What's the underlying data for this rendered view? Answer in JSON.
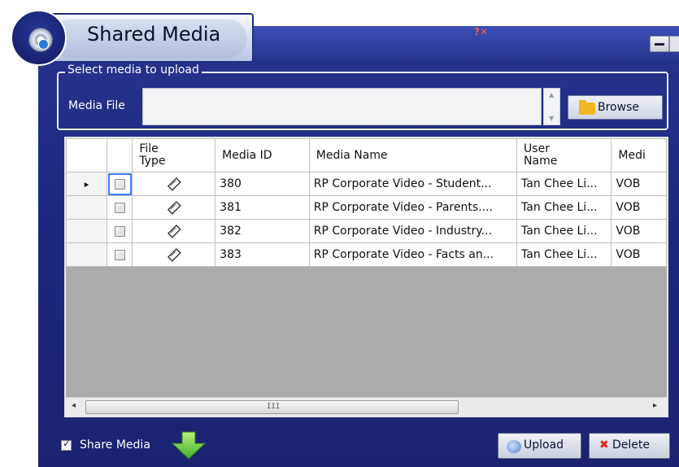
{
  "window": {
    "title": "Shared Media",
    "close_glyph": "?✕",
    "minimize_icon": "minimize-icon",
    "colors": {
      "frame": "#1d287e",
      "accent": "#3c4fb5",
      "group_border": "#e9ecf6",
      "grid_bg": "#ababab"
    }
  },
  "upload_section": {
    "legend": "Select media to upload",
    "media_file_label": "Media File",
    "media_file_value": "",
    "browse_label": "Browse",
    "browse_icon": "folder-icon"
  },
  "grid": {
    "columns": [
      "",
      "",
      "File Type",
      "Media ID",
      "Media Name",
      "User Name",
      "Medi"
    ],
    "rows": [
      {
        "selected": true,
        "checked": false,
        "file_type_icon": "film-reel-icon",
        "media_id": "380",
        "media_name": "RP Corporate Video - Student...",
        "user_name": "Tan Chee Li...",
        "media_type": "VOB"
      },
      {
        "selected": false,
        "checked": false,
        "file_type_icon": "film-reel-icon",
        "media_id": "381",
        "media_name": "RP Corporate Video - Parents....",
        "user_name": "Tan Chee Li...",
        "media_type": "VOB"
      },
      {
        "selected": false,
        "checked": false,
        "file_type_icon": "film-reel-icon",
        "media_id": "382",
        "media_name": "RP Corporate Video - Industry...",
        "user_name": "Tan Chee Li...",
        "media_type": "VOB"
      },
      {
        "selected": false,
        "checked": false,
        "file_type_icon": "film-reel-icon",
        "media_id": "383",
        "media_name": "RP Corporate Video - Facts an...",
        "user_name": "Tan Chee Li...",
        "media_type": "VOB"
      }
    ],
    "row_pointer": "▸",
    "scroll_grip": "III"
  },
  "footer": {
    "share_media_label": "Share Media",
    "share_media_checked": true,
    "upload_label": "Upload",
    "upload_icon": "upload-icon",
    "delete_label": "Delete",
    "delete_icon": "delete-x-icon",
    "arrow_icon": "green-down-arrow-icon"
  }
}
